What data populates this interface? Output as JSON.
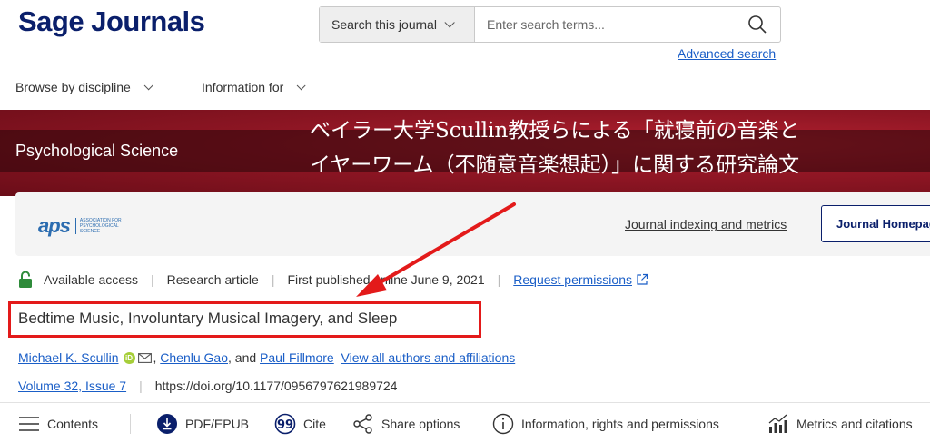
{
  "header": {
    "logo": "Sage Journals",
    "search_scope": "Search this journal",
    "search_placeholder": "Enter search terms...",
    "advanced_search": "Advanced search"
  },
  "nav": {
    "items": [
      {
        "label": "Browse by discipline"
      },
      {
        "label": "Information for"
      }
    ]
  },
  "banner": {
    "journal_name": "Psychological Science",
    "overlay_line1": "ベイラー大学Scullin教授らによる「就寝前の音楽と",
    "overlay_line2": "イヤーワーム（不随意音楽想起）」に関する研究論文"
  },
  "journal_card": {
    "logo_text": "aps",
    "logo_subtext": "ASSOCIATION FOR PSYCHOLOGICAL SCIENCE",
    "indexing_link": "Journal indexing and metrics",
    "homepage_button": "Journal Homepage"
  },
  "article": {
    "access": "Available access",
    "type": "Research article",
    "published": "First published online June 9, 2021",
    "request_permissions": "Request permissions",
    "title": "Bedtime Music, Involuntary Musical Imagery, and Sleep",
    "authors": {
      "first": "Michael K. Scullin",
      "second": "Chenlu Gao",
      "and": "and",
      "third": "Paul Fillmore",
      "view_all": "View all authors and affiliations"
    },
    "volume": "Volume 32, Issue 7",
    "doi": "https://doi.org/10.1177/0956797621989724"
  },
  "toolbar": {
    "contents": "Contents",
    "pdf": "PDF/EPUB",
    "cite": "Cite",
    "share": "Share options",
    "info": "Information, rights and permissions",
    "metrics": "Metrics and citations"
  },
  "colors": {
    "brand": "#0a1f6b",
    "link": "#1a5ec7",
    "banner": "#8f1624",
    "annotation": "#e31a1a"
  }
}
